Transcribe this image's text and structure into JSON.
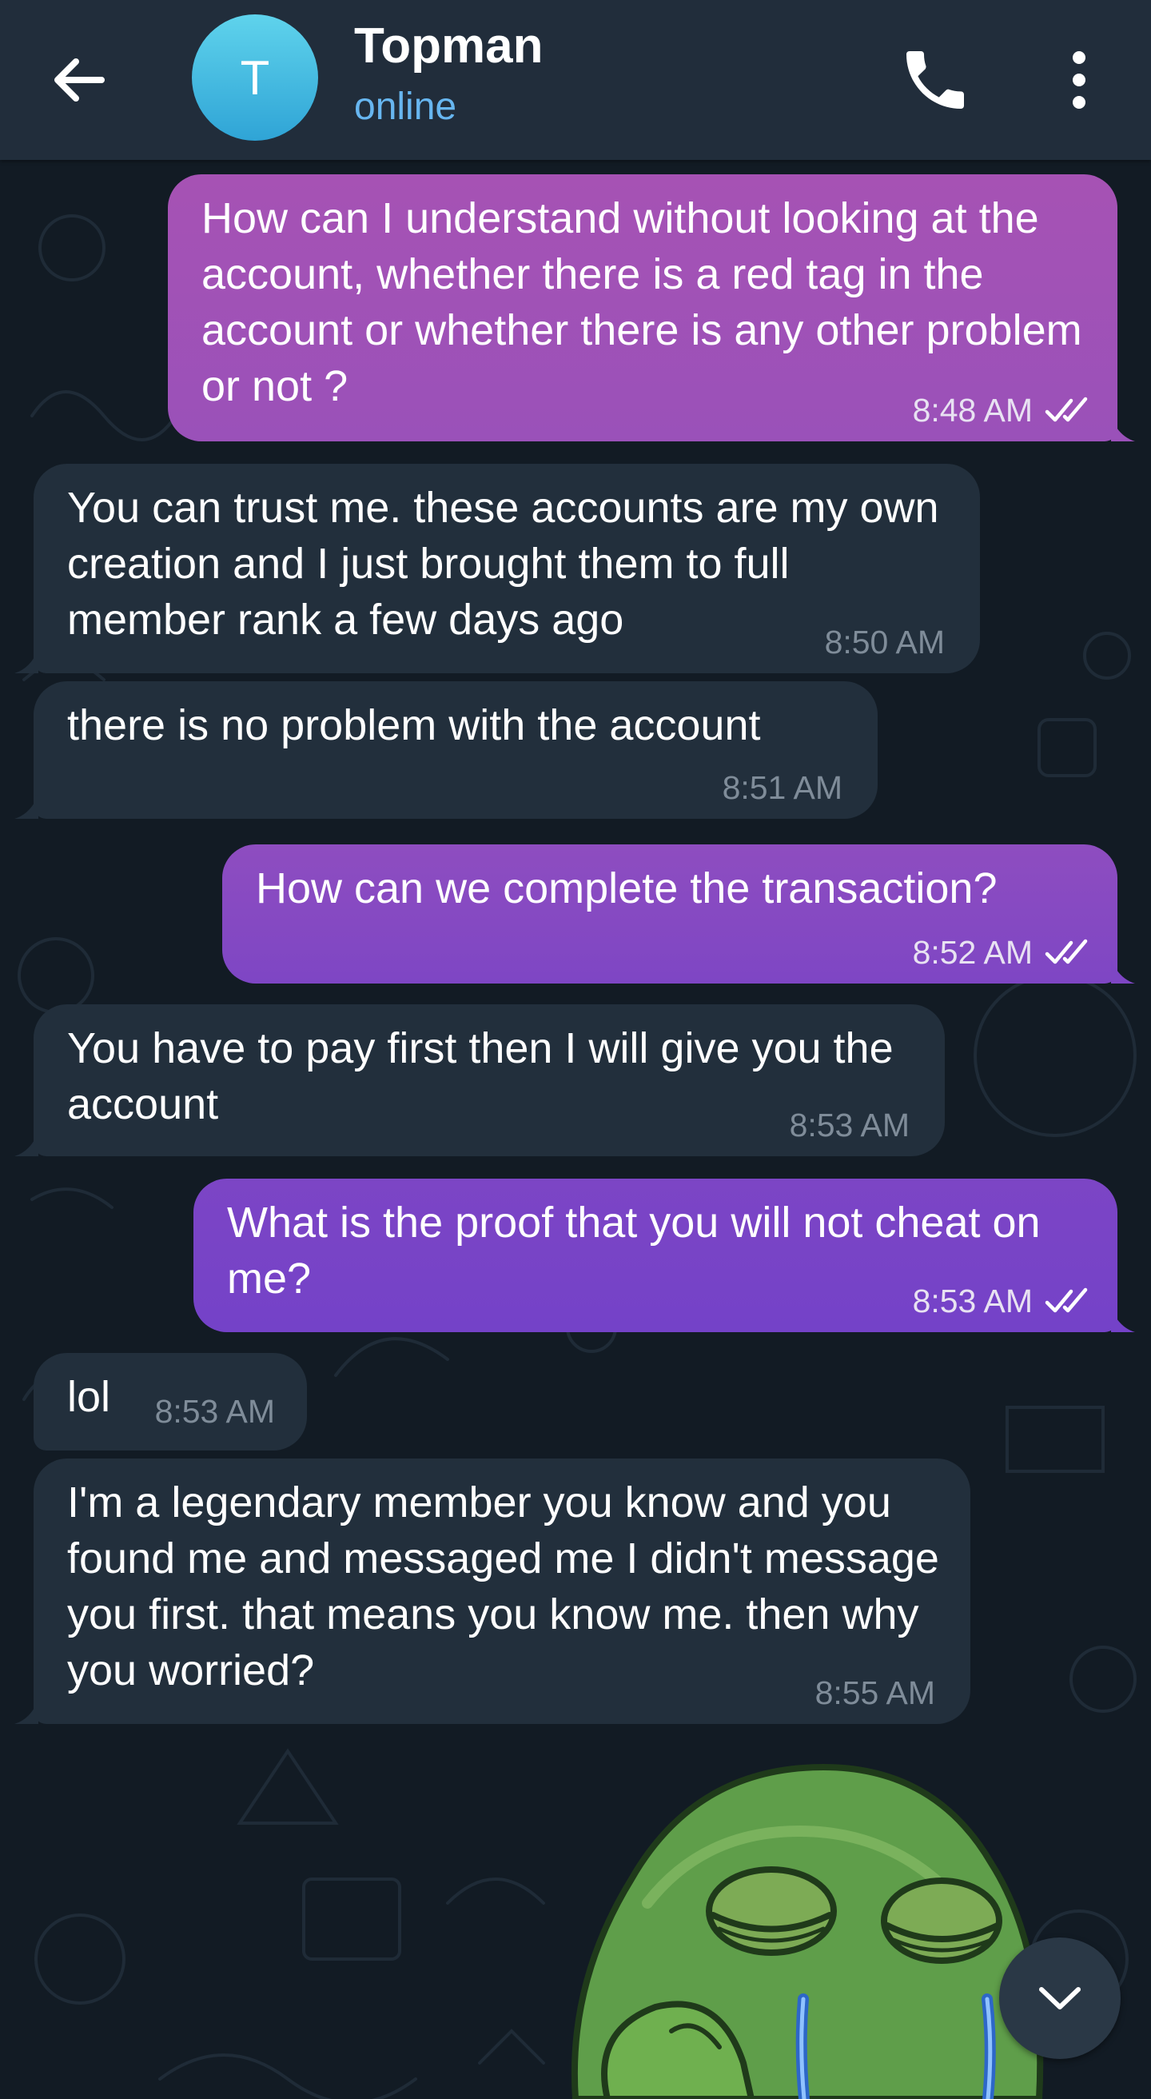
{
  "header": {
    "avatar_initial": "T",
    "title": "Topman",
    "status": "online"
  },
  "colors": {
    "header_bg": "#212d3b",
    "chat_bg": "#121b24",
    "incoming_bubble": "#222f3c",
    "outgoing_bubble_top": "#a653b5",
    "outgoing_bubble_bottom": "#7d45c4",
    "status_blue": "#67b6f0"
  },
  "messages": [
    {
      "direction": "out",
      "text": "How can I understand without looking at the account, whether there is a red tag in the account or whether there is any other problem or not ?",
      "time": "8:48 AM",
      "read": true
    },
    {
      "direction": "in",
      "text": "You can trust me. these accounts are my own creation and I just brought them to full member rank a few days ago",
      "time": "8:50 AM"
    },
    {
      "direction": "in",
      "text": "there is no problem with the account",
      "time": "8:51 AM"
    },
    {
      "direction": "out",
      "text": "How can we complete the transaction?",
      "time": "8:52 AM",
      "read": true
    },
    {
      "direction": "in",
      "text": "You have to pay first then I will give you the account",
      "time": "8:53 AM"
    },
    {
      "direction": "out",
      "text": "What is the proof that you will not cheat on me?",
      "time": "8:53 AM",
      "read": true
    },
    {
      "direction": "in",
      "text": "lol",
      "time": "8:53 AM"
    },
    {
      "direction": "in",
      "text": "I'm a legendary member you know and you found me and messaged me I didn't message you first. that means you know me. then why you worried?",
      "time": "8:55 AM"
    }
  ],
  "icons": {
    "back": "arrow-left-icon",
    "call": "phone-icon",
    "menu": "more-vertical-icon",
    "read_status": "double-check-icon",
    "scroll_down": "chevron-down-icon"
  }
}
